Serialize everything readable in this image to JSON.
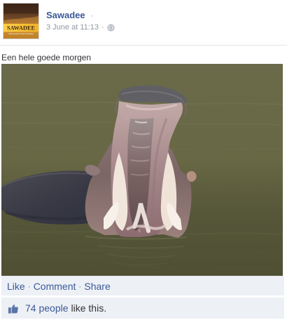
{
  "post": {
    "author": {
      "name": "Sawadee",
      "avatar_brand": "SAWADEE",
      "avatar_tagline": "Indonesian Food Company"
    },
    "meta": {
      "name_separator": "·",
      "timestamp": "3 June at 11:13",
      "meta_separator": "·",
      "privacy_icon": "globe-icon"
    },
    "message": "Een hele goede morgen",
    "photo": {
      "subject_icon": "hippo-photo"
    },
    "actions": {
      "like": "Like",
      "separator_1": "·",
      "comment": "Comment",
      "separator_2": "·",
      "share": "Share"
    },
    "likes": {
      "icon": "thumbs-up-icon",
      "count_text": "74 people",
      "suffix": "like this."
    }
  },
  "colors": {
    "link_blue": "#3b5998",
    "meta_gray": "#9197a3",
    "actions_background": "#edf0f5",
    "page_background": "#ffffff"
  }
}
